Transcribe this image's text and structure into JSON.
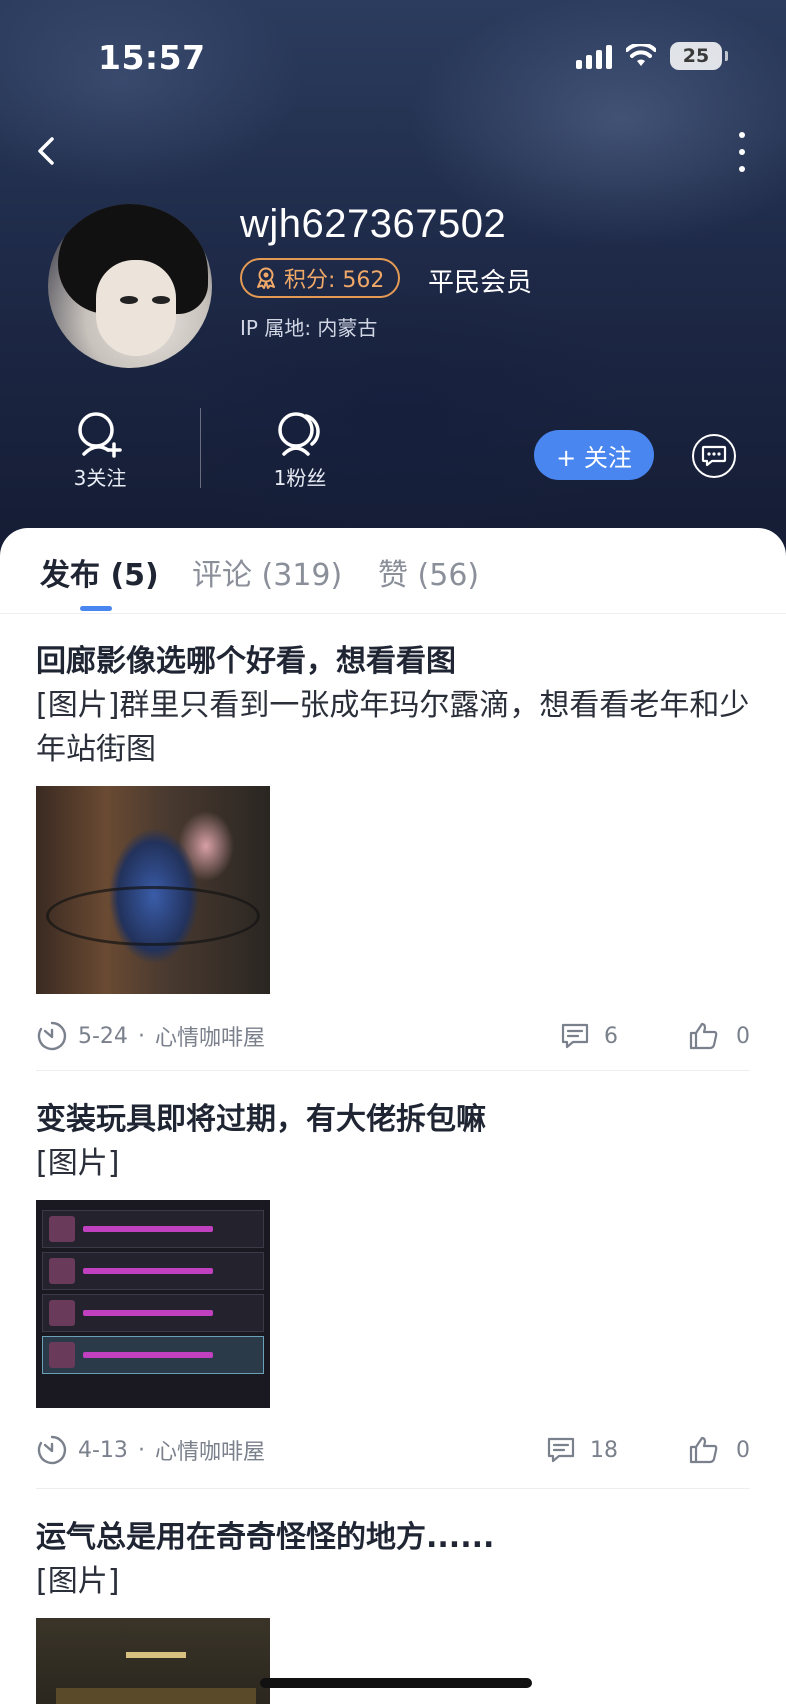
{
  "status_bar": {
    "time": "15:57",
    "battery": "25"
  },
  "profile": {
    "username": "wjh627367502",
    "points_label": "积分: 562",
    "member_level": "平民会员",
    "ip_location": "IP 属地:  内蒙古"
  },
  "stats": {
    "following_label": "3关注",
    "followers_label": "1粉丝"
  },
  "actions": {
    "follow_label": "+ 关注"
  },
  "tabs": [
    {
      "label": "发布 (5)",
      "active": true
    },
    {
      "label": "评论 (319)",
      "active": false
    },
    {
      "label": "赞 (56)",
      "active": false
    }
  ],
  "posts": [
    {
      "title": "回廊影像选哪个好看，想看看图",
      "body": "[图片]群里只看到一张成年玛尔露滴，想看看老年和少年站街图",
      "date": "5-24",
      "board": "心情咖啡屋",
      "comments": "6",
      "likes": "0"
    },
    {
      "title": "变装玩具即将过期，有大佬拆包嘛",
      "body": "[图片]",
      "date": "4-13",
      "board": "心情咖啡屋",
      "comments": "18",
      "likes": "0"
    },
    {
      "title": "运气总是用在奇奇怪怪的地方......",
      "body": "[图片]"
    }
  ],
  "colors": {
    "accent": "#4a86f0",
    "points": "#e59a54"
  }
}
